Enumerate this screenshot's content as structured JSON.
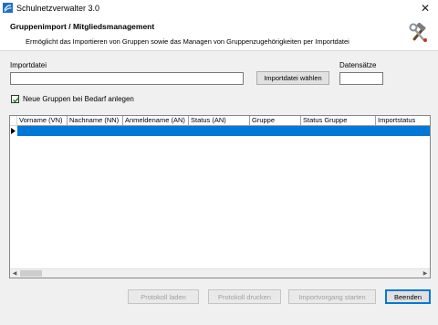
{
  "window": {
    "title": "Schulnetzverwalter 3.0",
    "close_glyph": "✕"
  },
  "header": {
    "title": "Gruppenimport / Mitgliedsmanagement",
    "description": "Ermöglicht das Importieren von Gruppen sowie das Managen von Gruppenzugehörigkeiten per Importdatei",
    "icon": "tools-icon"
  },
  "form": {
    "import_label": "Importdatei",
    "import_value": "",
    "import_button": "Importdatei wählen",
    "records_label": "Datensätze",
    "records_value": "",
    "checkbox_label": "Neue Gruppen bei Bedarf anlegen",
    "checkbox_checked": true
  },
  "grid": {
    "columns": [
      "Vorname (VN)",
      "Nachname (NN)",
      "Anmeldename (AN)",
      "Status (AN)",
      "Gruppe",
      "Status Gruppe",
      "Importstatus"
    ],
    "rows": [
      [
        "",
        "",
        "",
        "",
        "",
        "",
        ""
      ]
    ],
    "selection_color": "#0078d7"
  },
  "buttons": {
    "log_load": "Protokoll laden",
    "log_print": "Protokoll drucken",
    "start_import": "Importvorgang starten",
    "quit": "Beenden"
  },
  "colors": {
    "accent": "#0078d7",
    "window_bg": "#f0f0f0"
  }
}
